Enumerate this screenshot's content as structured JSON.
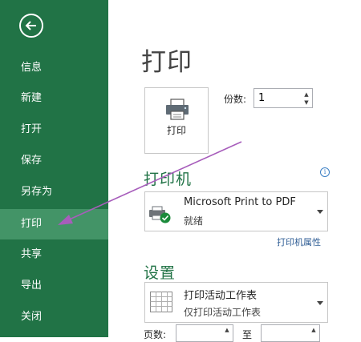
{
  "sidebar": {
    "items": [
      {
        "label": "信息",
        "active": false
      },
      {
        "label": "新建",
        "active": false
      },
      {
        "label": "打开",
        "active": false
      },
      {
        "label": "保存",
        "active": false
      },
      {
        "label": "另存为",
        "active": false
      },
      {
        "label": "打印",
        "active": true
      },
      {
        "label": "共享",
        "active": false
      },
      {
        "label": "导出",
        "active": false
      },
      {
        "label": "关闭",
        "active": false
      }
    ]
  },
  "main": {
    "title": "打印",
    "print_button_label": "打印",
    "copies": {
      "label": "份数:",
      "value": "1"
    },
    "printer": {
      "section_title": "打印机",
      "name": "Microsoft Print to PDF",
      "status": "就绪",
      "properties_link": "打印机属性"
    },
    "settings": {
      "section_title": "设置",
      "scope_main": "打印活动工作表",
      "scope_sub": "仅打印活动工作表",
      "pages_label": "页数:",
      "to_label": "至"
    }
  },
  "colors": {
    "sidebar_bg": "#217346",
    "sidebar_active": "#439467",
    "accent_text": "#217346",
    "annotation_arrow": "#a75dbb"
  },
  "icons": [
    "back-arrow-icon",
    "printer-icon",
    "printer-ready-icon",
    "info-icon",
    "sheet-grid-icon",
    "chevron-down-icon"
  ]
}
